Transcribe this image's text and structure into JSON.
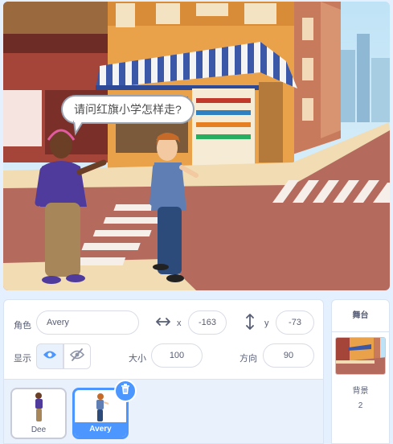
{
  "stage": {
    "speech_bubble": "请问红旗小学怎样走?"
  },
  "sprite_info": {
    "sprite_label": "角色",
    "sprite_name": "Avery",
    "x_label": "x",
    "x_value": "-163",
    "y_label": "y",
    "y_value": "-73",
    "show_label": "显示",
    "size_label": "大小",
    "size_value": "100",
    "direction_label": "方向",
    "direction_value": "90"
  },
  "sprites": [
    {
      "name": "Dee",
      "selected": false
    },
    {
      "name": "Avery",
      "selected": true
    }
  ],
  "stage_pane": {
    "title": "舞台",
    "backdrops_label": "背景",
    "backdrops_count": "2"
  },
  "colors": {
    "accent": "#4c97ff",
    "panel_bg": "#e9f1fc",
    "text": "#575e75"
  }
}
